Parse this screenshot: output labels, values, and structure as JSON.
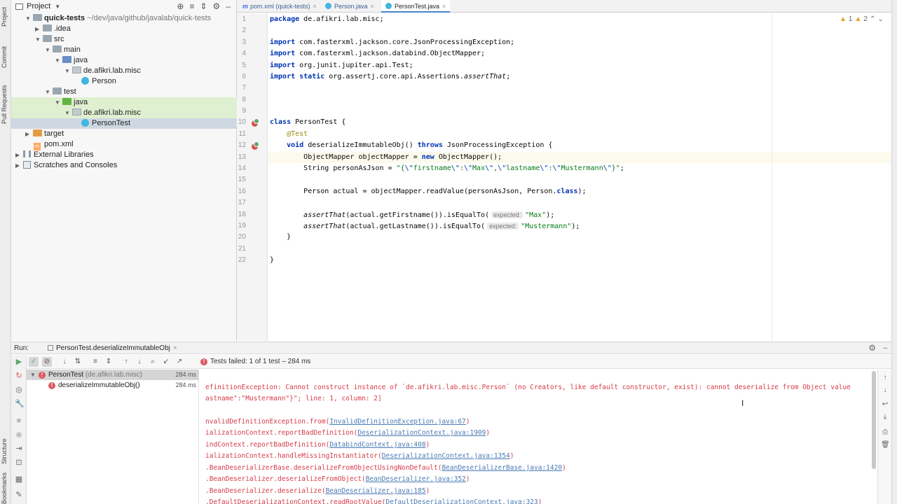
{
  "left_strip": {
    "tabs": [
      "Project",
      "Commit",
      "Pull Requests",
      "Structure",
      "Bookmarks"
    ]
  },
  "project": {
    "title": "Project",
    "tree": [
      {
        "label": "quick-tests",
        "suffix": "~/dev/java/github/javalab/quick-tests",
        "icon": "module-folder-icon",
        "expanded": true
      },
      {
        "label": ".idea",
        "icon": "folder-icon",
        "expanded": false
      },
      {
        "label": "src",
        "icon": "folder-icon",
        "expanded": true
      },
      {
        "label": "main",
        "icon": "folder-icon",
        "expanded": true
      },
      {
        "label": "java",
        "icon": "source-folder-icon",
        "expanded": true
      },
      {
        "label": "de.afikri.lab.misc",
        "icon": "package-icon",
        "expanded": true
      },
      {
        "label": "Person",
        "icon": "class-icon"
      },
      {
        "label": "test",
        "icon": "folder-icon",
        "expanded": true
      },
      {
        "label": "java",
        "icon": "test-folder-icon",
        "expanded": true
      },
      {
        "label": "de.afikri.lab.misc",
        "icon": "package-icon",
        "expanded": true
      },
      {
        "label": "PersonTest",
        "icon": "class-icon"
      },
      {
        "label": "target",
        "icon": "excluded-folder-icon",
        "expanded": false
      },
      {
        "label": "pom.xml",
        "icon": "maven-icon"
      },
      {
        "label": "External Libraries",
        "icon": "library-icon",
        "expanded": false
      },
      {
        "label": "Scratches and Consoles",
        "icon": "scratches-icon",
        "expanded": false
      }
    ]
  },
  "editor": {
    "tabs": [
      {
        "label": "pom.xml (quick-tests)",
        "icon": "maven-icon"
      },
      {
        "label": "Person.java",
        "icon": "class-icon"
      },
      {
        "label": "PersonTest.java",
        "icon": "class-icon",
        "active": true
      }
    ],
    "inspection": {
      "warnings": "1",
      "weak": "2"
    },
    "line_numbers": [
      "1",
      "2",
      "3",
      "4",
      "5",
      "6",
      "7",
      "8",
      "9",
      "10",
      "11",
      "12",
      "13",
      "14",
      "15",
      "16",
      "17",
      "18",
      "19",
      "20",
      "21",
      "22"
    ],
    "code": {
      "l1_kw": "package",
      "l1_rest": " de.afikri.lab.misc;",
      "l3_kw": "import",
      "l3_rest": " com.fasterxml.jackson.core.JsonProcessingException;",
      "l4_kw": "import",
      "l4_rest": " com.fasterxml.jackson.databind.ObjectMapper;",
      "l5_kw": "import",
      "l5_rest": " org.junit.jupiter.api.Test;",
      "l6_kw": "import static",
      "l6_rest": " org.assertj.core.api.Assertions.",
      "l6_it": "assertThat",
      "l6_end": ";",
      "l10_kw": "class",
      "l10_rest": " PersonTest {",
      "l11_ann": "@Test",
      "l12_kw": "void",
      "l12_rest": " deserializeImmutableObj() ",
      "l12_kw2": "throws",
      "l12_end": " JsonProcessingException {",
      "l13_a": "ObjectMapper objectMapper = ",
      "l13_kw": "new",
      "l13_b": " ObjectMapper();",
      "l14_a": "String personAsJson = ",
      "l14_q1": "\"{",
      "l14_e1": "\\\"",
      "l14_s1": "firstname",
      "l14_e2": "\\\"",
      "l14_s2": ":",
      "l14_e3": "\\\"",
      "l14_s3": "Max",
      "l14_e4": "\\\"",
      "l14_s4": ",",
      "l14_e5": "\\\"",
      "l14_s5": "lastname",
      "l14_e6": "\\\"",
      "l14_s6": ":",
      "l14_e7": "\\\"",
      "l14_s7": "Mustermann",
      "l14_e8": "\\\"",
      "l14_q2": "}\"",
      "l14_end": ";",
      "l16_a": "Person actual = objectMapper.readValue(personAsJson, Person.",
      "l16_kw": "class",
      "l16_end": ");",
      "l18_it": "assertThat",
      "l18_a": "(actual.getFirstname()).isEqualTo(",
      "l18_hint": "expected:",
      "l18_str": "\"Max\"",
      "l18_end": ");",
      "l19_it": "assertThat",
      "l19_a": "(actual.getLastname()).isEqualTo(",
      "l19_hint": "expected:",
      "l19_str": "\"Mustermann\"",
      "l19_end": ");",
      "l20": "}",
      "l22": "}"
    }
  },
  "run": {
    "label": "Run:",
    "tab": "PersonTest.deserializeImmutableObj",
    "status": "Tests failed:",
    "status_detail": "1 of 1 test – 284 ms",
    "tests": [
      {
        "name": "PersonTest",
        "suffix": "(de.afikri.lab.misc)",
        "duration": "284 ms"
      },
      {
        "name": "deserializeImmutableObj()",
        "duration": "284 ms"
      }
    ],
    "console": {
      "line1": "efinitionException: Cannot construct instance of `de.afikri.lab.misc.Person` (no Creators, like default constructor, exist): cannot deserialize from Object value",
      "line2": "astname\":\"Mustermann\"}\"; line: 1, column: 2]",
      "stack": [
        {
          "pre": "nvalidDefinitionException.from(",
          "link": "InvalidDefinitionException.java:67",
          "post": ")"
        },
        {
          "pre": "ializationContext.reportBadDefinition(",
          "link": "DeserializationContext.java:1909",
          "post": ")"
        },
        {
          "pre": "indContext.reportBadDefinition(",
          "link": "DatabindContext.java:408",
          "post": ")"
        },
        {
          "pre": "ializationContext.handleMissingInstantiator(",
          "link": "DeserializationContext.java:1354",
          "post": ")"
        },
        {
          "pre": ".BeanDeserializerBase.deserializeFromObjectUsingNonDefault(",
          "link": "BeanDeserializerBase.java:1420",
          "post": ")"
        },
        {
          "pre": ".BeanDeserializer.deserializeFromObject(",
          "link": "BeanDeserializer.java:352",
          "post": ")"
        },
        {
          "pre": ".BeanDeserializer.deserialize(",
          "link": "BeanDeserializer.java:185",
          "post": ")"
        },
        {
          "pre": ".DefaultDeserializationContext.readRootValue(",
          "link": "DefaultDeserializationContext.java:323",
          "post": ")"
        }
      ]
    }
  },
  "colors": {
    "keyword": "#0033b3",
    "string": "#067d17",
    "annotation": "#9e880d",
    "error": "#db5860",
    "link": "#4a7ab5",
    "selection": "#cfd8e2",
    "test_folder": "#dff0d0"
  }
}
